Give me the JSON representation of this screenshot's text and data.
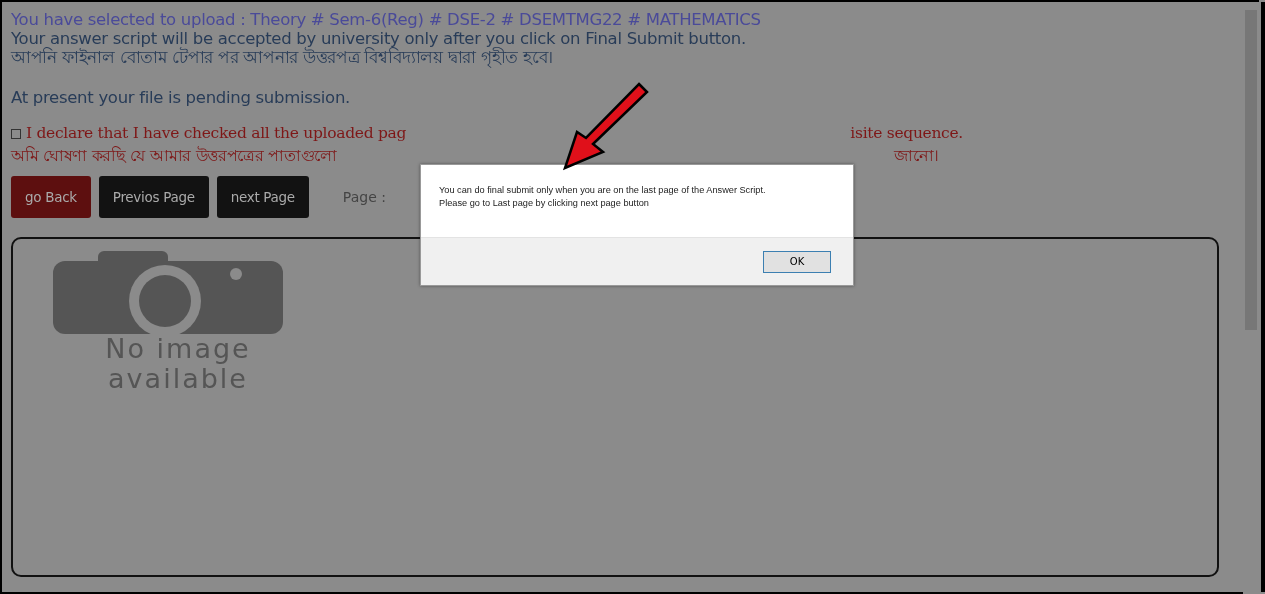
{
  "header_lines": [
    {
      "kind": "selection",
      "text": "You have selected to upload : Theory # Sem-6(Reg) # DSE-2 # DSEMTMG22 # MATHEMATICS"
    },
    {
      "kind": "info",
      "text": "Your answer script will be accepted by university only after you click on Final Submit button."
    },
    {
      "kind": "info",
      "text": "আপনি ফাইনাল বোতাম টেপার পর আপনার উত্তরপত্র বিশ্ববিদ্যালয় দ্বারা গৃহীত হবে।"
    }
  ],
  "status_text": "At present your file is pending submission.",
  "declaration": {
    "checked": false,
    "line_1_start": "I declare that I have checked all the uploaded pag",
    "line_1_end": "isite sequence.",
    "line_2_start": "অমি ঘোষণা করছি যে আমার উত্তরপত্রের পাতাগুলো",
    "line_2_end": "জানো।"
  },
  "buttons": [
    {
      "kind": "danger",
      "label": "go Back"
    },
    {
      "kind": "dark",
      "label": "Previos Page"
    },
    {
      "kind": "dark",
      "label": "next Page"
    }
  ],
  "page_label": "Page :",
  "preview": {
    "placeholder_lines": [
      "No image",
      "available"
    ]
  },
  "dialog": {
    "message_lines": [
      "You can do final submit only when you are on the last page of the Answer Script.",
      "Please go to Last page by clicking next page button"
    ],
    "ok_label": "OK"
  }
}
